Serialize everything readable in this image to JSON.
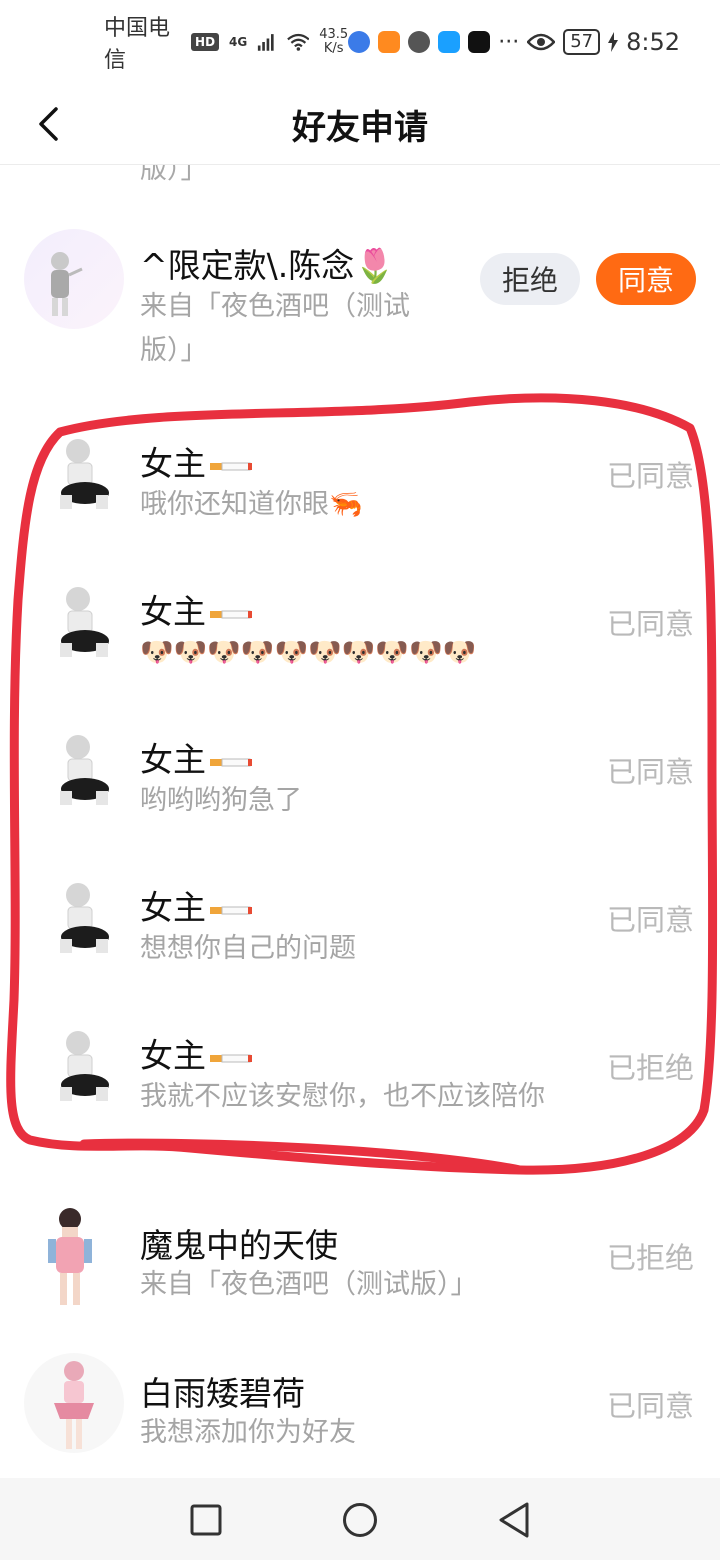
{
  "status_bar": {
    "carrier": "中国电信",
    "hd": "HD",
    "network": "4G",
    "speed_top": "43.5",
    "speed_bottom": "K/s",
    "more": "···",
    "battery": "57",
    "time": "8:52"
  },
  "header": {
    "title": "好友申请"
  },
  "cut_text": "版）」",
  "requests": [
    {
      "name": "^限定款\\.陈念🌷",
      "message": "来自「夜色酒吧（测试版）」",
      "reject_label": "拒绝",
      "agree_label": "同意"
    },
    {
      "name": "女主",
      "message": "哦你还知道你眼🦐",
      "status": "已同意"
    },
    {
      "name": "女主",
      "message": "🐶🐶🐶🐶🐶🐶🐶🐶🐶🐶",
      "status": "已同意"
    },
    {
      "name": "女主",
      "message": "哟哟哟狗急了",
      "status": "已同意"
    },
    {
      "name": "女主",
      "message": "想想你自己的问题",
      "status": "已同意"
    },
    {
      "name": "女主",
      "message": "我就不应该安慰你，也不应该陪你",
      "status": "已拒绝"
    },
    {
      "name": "魔鬼中的天使",
      "message": "来自「夜色酒吧（测试版）」",
      "status": "已拒绝"
    },
    {
      "name": "白雨矮碧荷",
      "message": "我想添加你为好友",
      "status": "已同意"
    }
  ],
  "colors": {
    "agree": "#ff6a13",
    "reject_bg": "#eceef3",
    "annotation": "#e8303f"
  }
}
